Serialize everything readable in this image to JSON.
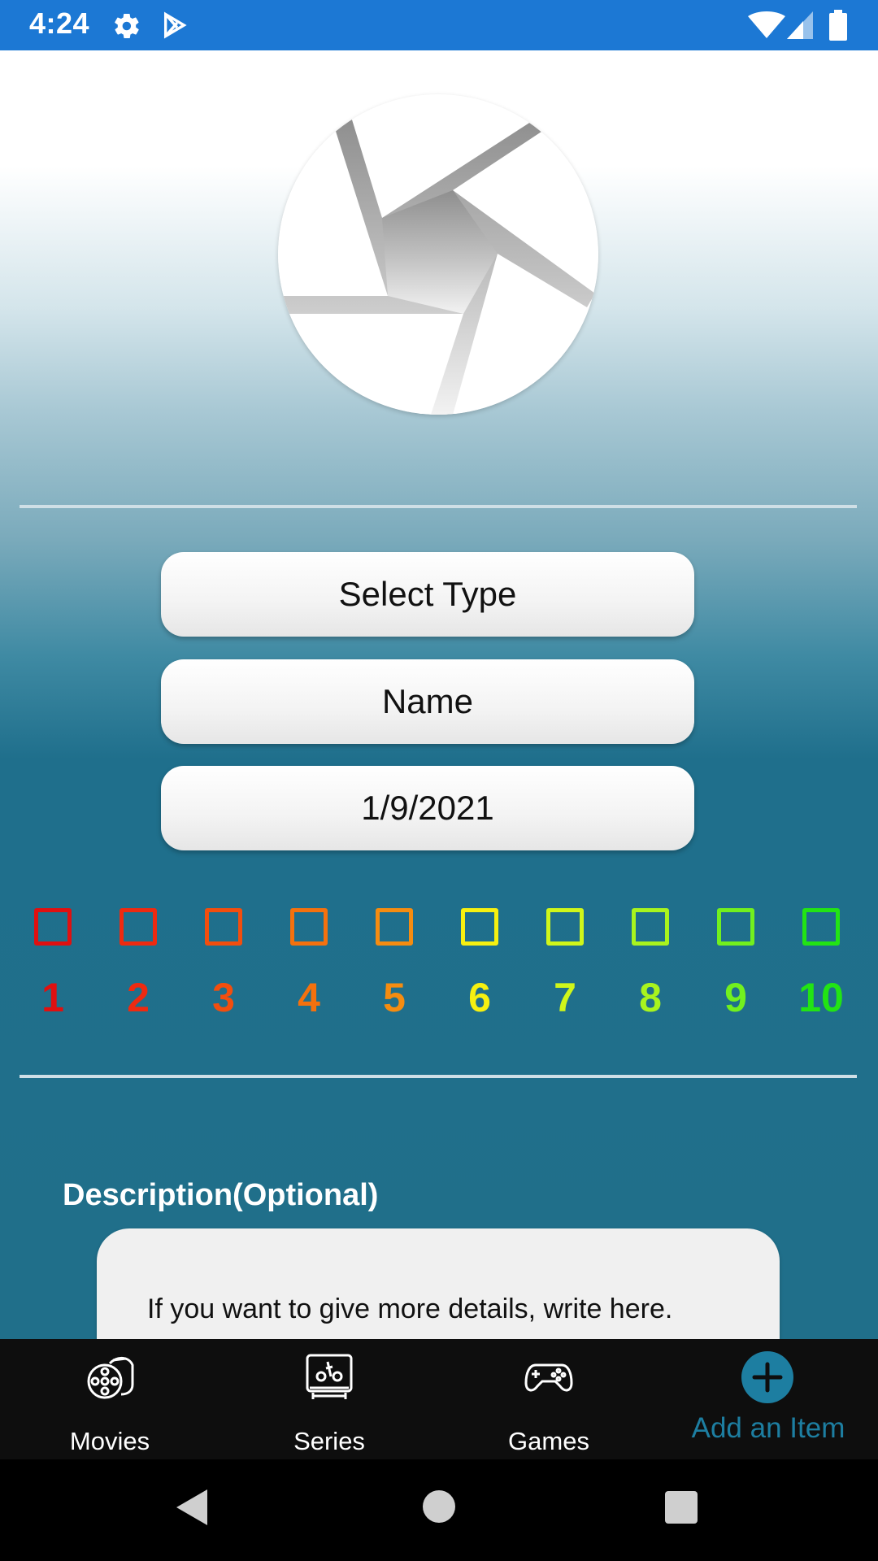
{
  "status_bar": {
    "time": "4:24",
    "icons": [
      "gear-icon",
      "play-store-icon",
      "wifi-icon",
      "signal-icon",
      "battery-icon"
    ]
  },
  "form": {
    "select_type_label": "Select Type",
    "name_placeholder": "Name",
    "date_value": "1/9/2021",
    "description_label": "Description(Optional)",
    "description_placeholder": "If you want to give more details, write here."
  },
  "rating": {
    "options": [
      {
        "label": "1",
        "color": "#e01010"
      },
      {
        "label": "2",
        "color": "#ee2a10"
      },
      {
        "label": "3",
        "color": "#f24e0e"
      },
      {
        "label": "4",
        "color": "#f4710e"
      },
      {
        "label": "5",
        "color": "#f58c10"
      },
      {
        "label": "6",
        "color": "#f6f010"
      },
      {
        "label": "7",
        "color": "#d0f61a"
      },
      {
        "label": "8",
        "color": "#a8f41e"
      },
      {
        "label": "9",
        "color": "#72f01e"
      },
      {
        "label": "10",
        "color": "#22e414"
      }
    ]
  },
  "bottom_nav": {
    "items": [
      {
        "label": "Movies",
        "icon": "film-reel-icon"
      },
      {
        "label": "Series",
        "icon": "tv-icon"
      },
      {
        "label": "Games",
        "icon": "gamepad-icon"
      },
      {
        "label": "Add an Item",
        "icon": "add-circle-icon",
        "active": true
      }
    ],
    "active_color": "#1d7ea1"
  },
  "colors": {
    "status_bar": "#1c78d4",
    "accent": "#1d7ea1",
    "background_bottom": "#206f8a"
  }
}
